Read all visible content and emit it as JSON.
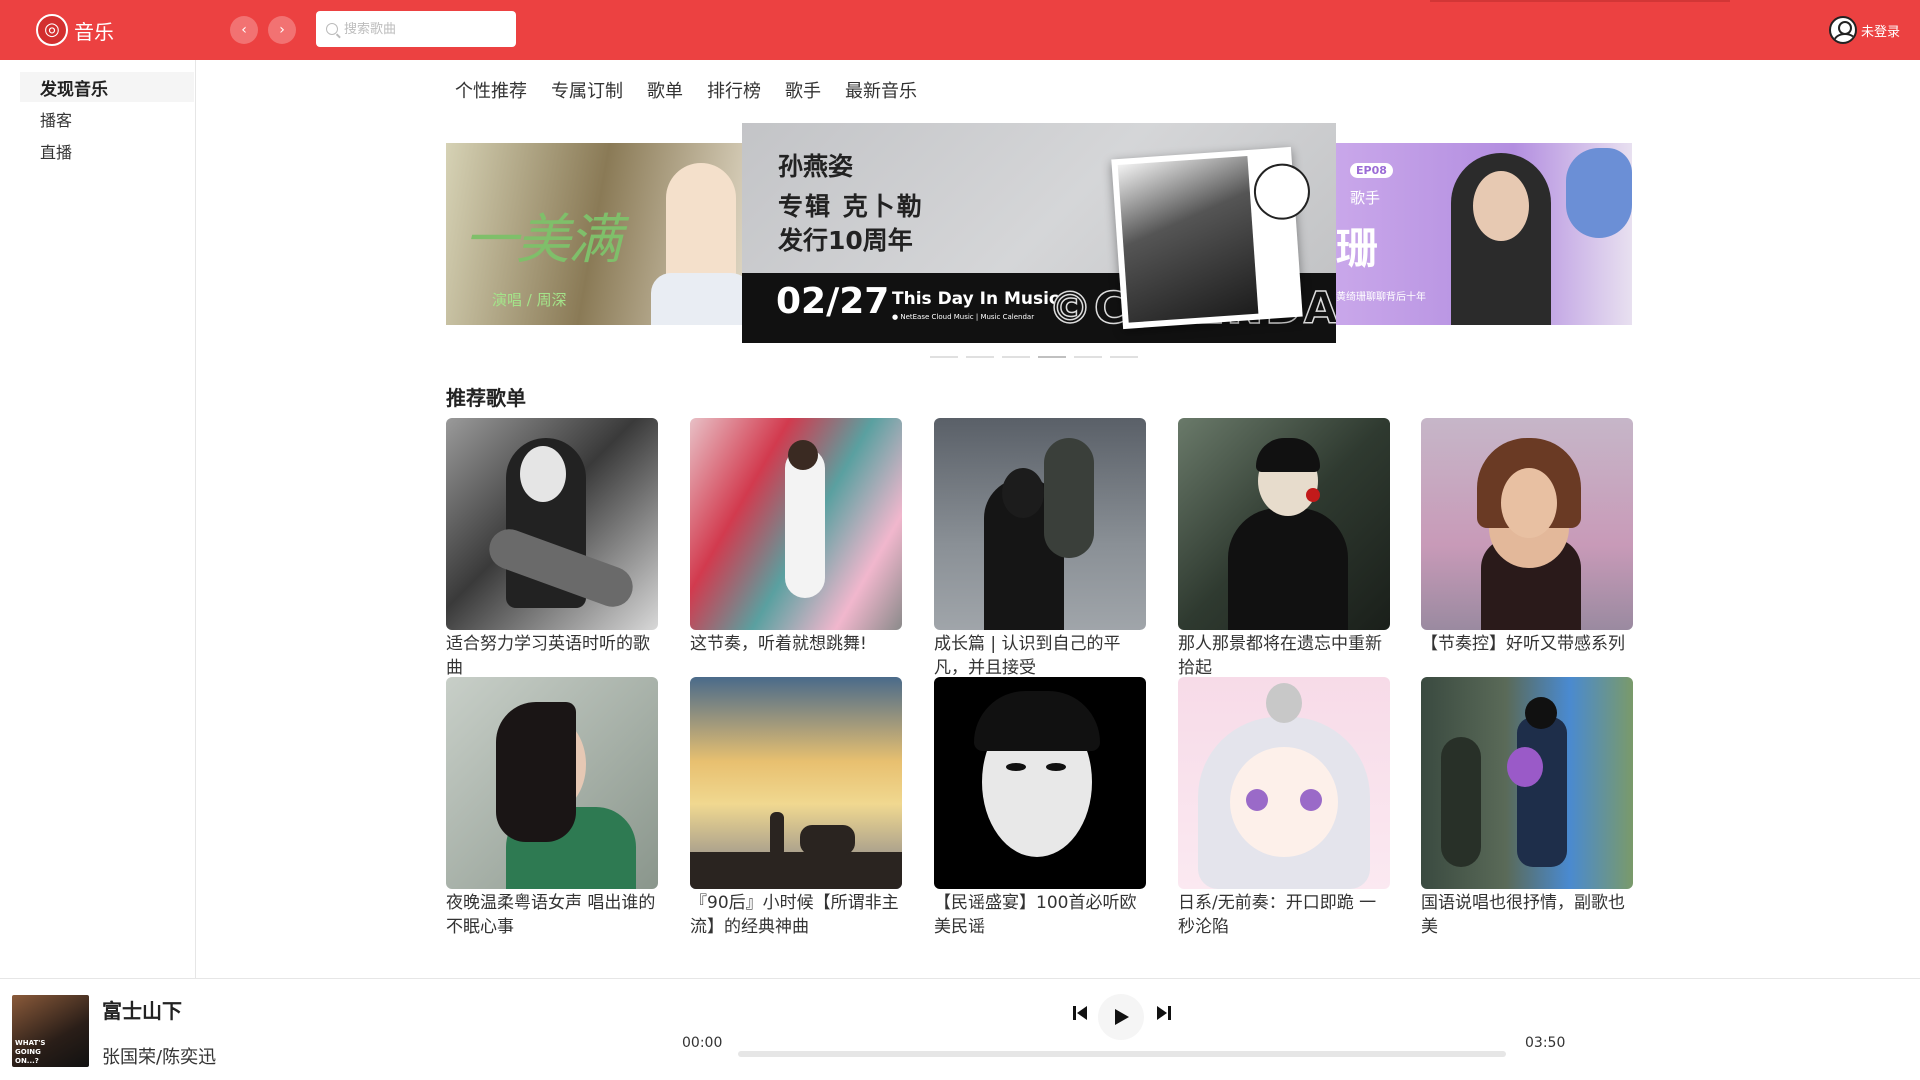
{
  "header": {
    "app_name": "音乐",
    "search_placeholder": "搜索歌曲",
    "user_label": "未登录",
    "accent": "#ec4141"
  },
  "sidebar": {
    "items": [
      {
        "label": "发现音乐",
        "active": true
      },
      {
        "label": "播客",
        "active": false
      },
      {
        "label": "直播",
        "active": false
      }
    ]
  },
  "tabs": [
    "个性推荐",
    "专属订制",
    "歌单",
    "排行榜",
    "歌手",
    "最新音乐"
  ],
  "banner": {
    "left": {
      "title": "一美满",
      "subtitle": "演唱 / 周深"
    },
    "main": {
      "line1": "孙燕姿",
      "line2": "专辑 克卜勒",
      "line3": "发行10周年",
      "date": "02/27",
      "tagline": "This Day In Music",
      "tagline_sub": "● NetEase Cloud Music | Music Calendar",
      "calendar": "©CALENDAR"
    },
    "right": {
      "badge": "EP08",
      "label": "歌手",
      "big": "珊",
      "small": "黄绮珊聊聊背后十年"
    },
    "slide_count": 6,
    "active_slide": 3
  },
  "recommend": {
    "title": "推荐歌单",
    "playlists": [
      {
        "name": "适合努力学习英语时听的歌曲"
      },
      {
        "name": "这节奏，听着就想跳舞!"
      },
      {
        "name": "成长篇 | 认识到自己的平凡，并且接受"
      },
      {
        "name": "那人那景都将在遗忘中重新拾起"
      },
      {
        "name": "【节奏控】好听又带感系列"
      },
      {
        "name": "夜晚温柔粤语女声 唱出谁的不眠心事"
      },
      {
        "name": "『90后』小时候【所谓非主流】的经典神曲"
      },
      {
        "name": "【民谣盛宴】100首必听欧美民谣"
      },
      {
        "name": "日系/无前奏：开口即跪 一秒沦陷"
      },
      {
        "name": "国语说唱也很抒情，副歌也美"
      }
    ]
  },
  "player": {
    "song": "富士山下",
    "artist": "张国荣/陈奕迅",
    "current_time": "00:00",
    "total_time": "03:50",
    "progress": 0
  }
}
